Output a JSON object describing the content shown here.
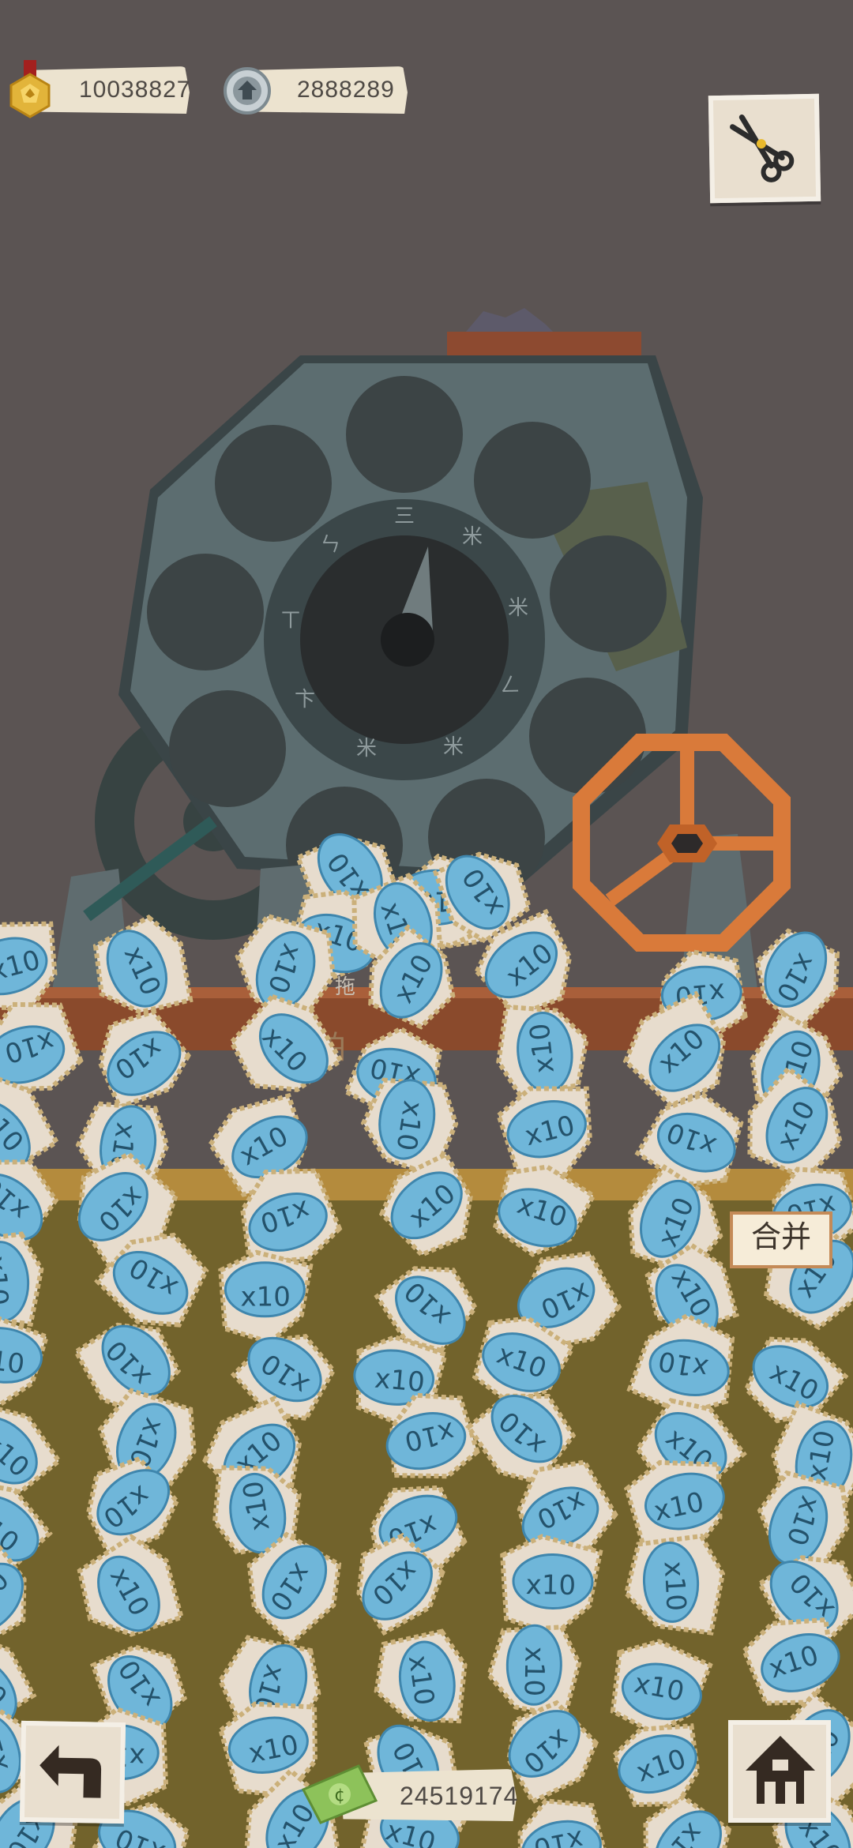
{
  "hud": {
    "gold_value": "10038827",
    "gear_value": "2888289",
    "cash_value": "24519174"
  },
  "machine": {
    "dial_glyphs": [
      "三",
      "米",
      "米",
      "ㄥ",
      "米",
      "米",
      "卞",
      "ㄒ",
      "ㄣ"
    ],
    "partial_text_1": "拖",
    "partial_text_2": "0 铂",
    "partial_text_3": "0"
  },
  "buttons": {
    "merge_label": "合并"
  },
  "tiles": {
    "multiplier_label": "x10"
  },
  "icons": {
    "gold": "gold-medal-icon",
    "gear": "gear-coin-icon",
    "cash": "cash-icon",
    "tool": "scissors-tool-icon",
    "back": "back-arrow-icon",
    "home": "home-icon"
  },
  "colors": {
    "background": "#5b5453",
    "tile_blue": "#6fb6d9",
    "tile_paper": "#e7dccd",
    "wheel_orange": "#d97a3a"
  }
}
